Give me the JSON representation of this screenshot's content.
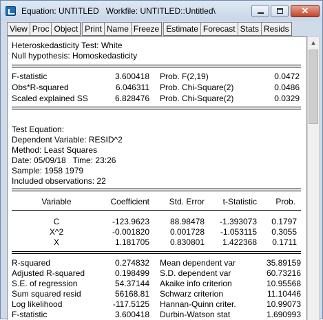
{
  "window": {
    "title": "Equation: UNTITLED   Workfile: UNTITLED::Untitled\\",
    "close_glyph": "✕"
  },
  "toolbar": {
    "groups": [
      [
        "View",
        "Proc",
        "Object"
      ],
      [
        "Print",
        "Name",
        "Freeze"
      ],
      [
        "Estimate",
        "Forecast",
        "Stats",
        "Resids"
      ]
    ]
  },
  "heading": {
    "test": "Heteroskedasticity Test: White",
    "null": "Null hypothesis: Homoskedasticity"
  },
  "test_stats": [
    {
      "label": "F-statistic",
      "value": "3.600418",
      "prob_label": "Prob. F(2,19)",
      "prob": "0.0472"
    },
    {
      "label": "Obs*R-squared",
      "value": "6.046311",
      "prob_label": "Prob. Chi-Square(2)",
      "prob": "0.0486"
    },
    {
      "label": "Scaled explained SS",
      "value": "6.828476",
      "prob_label": "Prob. Chi-Square(2)",
      "prob": "0.0329"
    }
  ],
  "equation_info": {
    "title": "Test Equation:",
    "dependent": "Dependent Variable: RESID^2",
    "method": "Method: Least Squares",
    "date": "Date: 05/09/18   Time: 23:26",
    "sample": "Sample: 1958 1979",
    "obs": "Included observations: 22"
  },
  "coef_table": {
    "headers": [
      "Variable",
      "Coefficient",
      "Std. Error",
      "t-Statistic",
      "Prob."
    ],
    "rows": [
      [
        "C",
        "-123.9623",
        "88.98478",
        "-1.393073",
        "0.1797"
      ],
      [
        "X^2",
        "-0.001820",
        "0.001728",
        "-1.053115",
        "0.3055"
      ],
      [
        "X",
        "1.181705",
        "0.830801",
        "1.422368",
        "0.1711"
      ]
    ]
  },
  "summary": [
    {
      "l1": "R-squared",
      "v1": "0.274832",
      "l2": "Mean dependent var",
      "v2": "35.89159"
    },
    {
      "l1": "Adjusted R-squared",
      "v1": "0.198499",
      "l2": "S.D. dependent var",
      "v2": "60.73216"
    },
    {
      "l1": "S.E. of regression",
      "v1": "54.37144",
      "l2": "Akaike info criterion",
      "v2": "10.95568"
    },
    {
      "l1": "Sum squared resid",
      "v1": "56168.81",
      "l2": "Schwarz criterion",
      "v2": "11.10446"
    },
    {
      "l1": "Log likelihood",
      "v1": "-117.5125",
      "l2": "Hannan-Quinn criter.",
      "v2": "10.99073"
    },
    {
      "l1": "F-statistic",
      "v1": "3.600418",
      "l2": "Durbin-Watson stat",
      "v2": "1.690993"
    }
  ],
  "scrollbar": {
    "up_arrow": "▲"
  }
}
